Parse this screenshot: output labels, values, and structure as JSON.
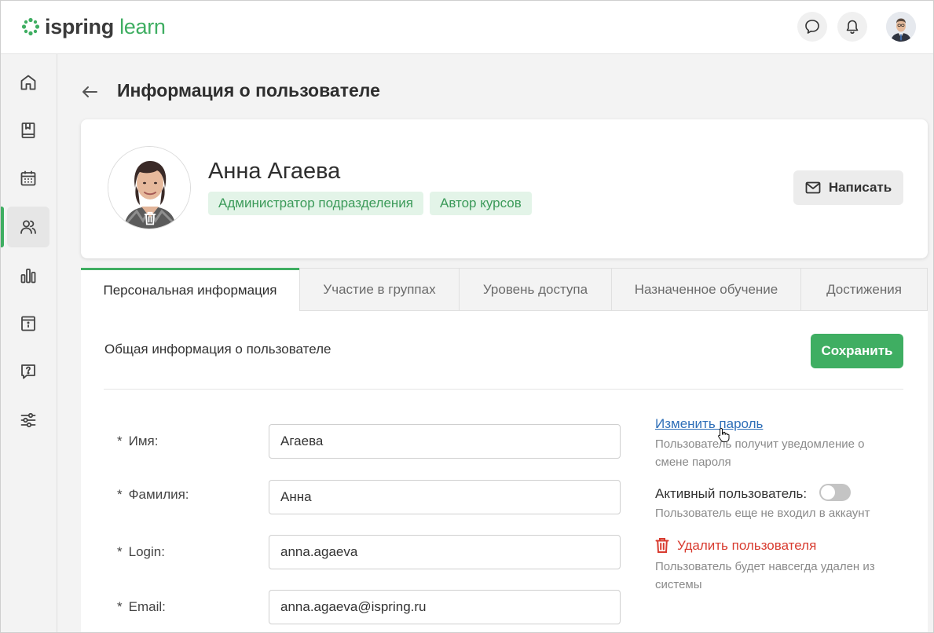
{
  "app": {
    "logo_part1": "ispring",
    "logo_part2": "learn",
    "brand_color": "#3fae62"
  },
  "header": {
    "chat_icon": "chat-bubble-icon",
    "notifications_icon": "bell-icon"
  },
  "sidebar": {
    "items": [
      {
        "icon": "home-icon",
        "active": false
      },
      {
        "icon": "book-icon",
        "active": false
      },
      {
        "icon": "calendar-icon",
        "active": false
      },
      {
        "icon": "users-icon",
        "active": true
      },
      {
        "icon": "bar-chart-icon",
        "active": false
      },
      {
        "icon": "info-book-icon",
        "active": false
      },
      {
        "icon": "question-icon",
        "active": false
      },
      {
        "icon": "sliders-icon",
        "active": false
      }
    ]
  },
  "page": {
    "title": "Информация о пользователе"
  },
  "profile": {
    "name": "Анна Агаева",
    "tags": [
      "Администратор подразделения",
      "Автор курсов"
    ],
    "write_button": "Написать"
  },
  "tabs": [
    {
      "label": "Персональная информация",
      "active": true
    },
    {
      "label": "Участие в группах",
      "active": false
    },
    {
      "label": "Уровень доступа",
      "active": false
    },
    {
      "label": "Назначенное обучение",
      "active": false
    },
    {
      "label": "Достижения",
      "active": false
    }
  ],
  "form": {
    "section_title": "Общая информация о пользователе",
    "save_button": "Сохранить",
    "required_mark": "*",
    "fields": [
      {
        "label": "Имя:",
        "value": "Агаева"
      },
      {
        "label": "Фамилия:",
        "value": "Анна"
      },
      {
        "label": "Login:",
        "value": "anna.agaeva"
      },
      {
        "label": "Email:",
        "value": "anna.agaeva@ispring.ru"
      }
    ]
  },
  "side": {
    "change_password": "Изменить пароль",
    "change_password_hint": "Пользователь получит уведомление о смене пароля",
    "active_user_label": "Активный пользователь:",
    "active_user_enabled": false,
    "active_user_hint": "Пользователь еще не входил в аккаунт",
    "delete_user": "Удалить пользователя",
    "delete_user_hint": "Пользователь будет навсегда удален из системы"
  }
}
